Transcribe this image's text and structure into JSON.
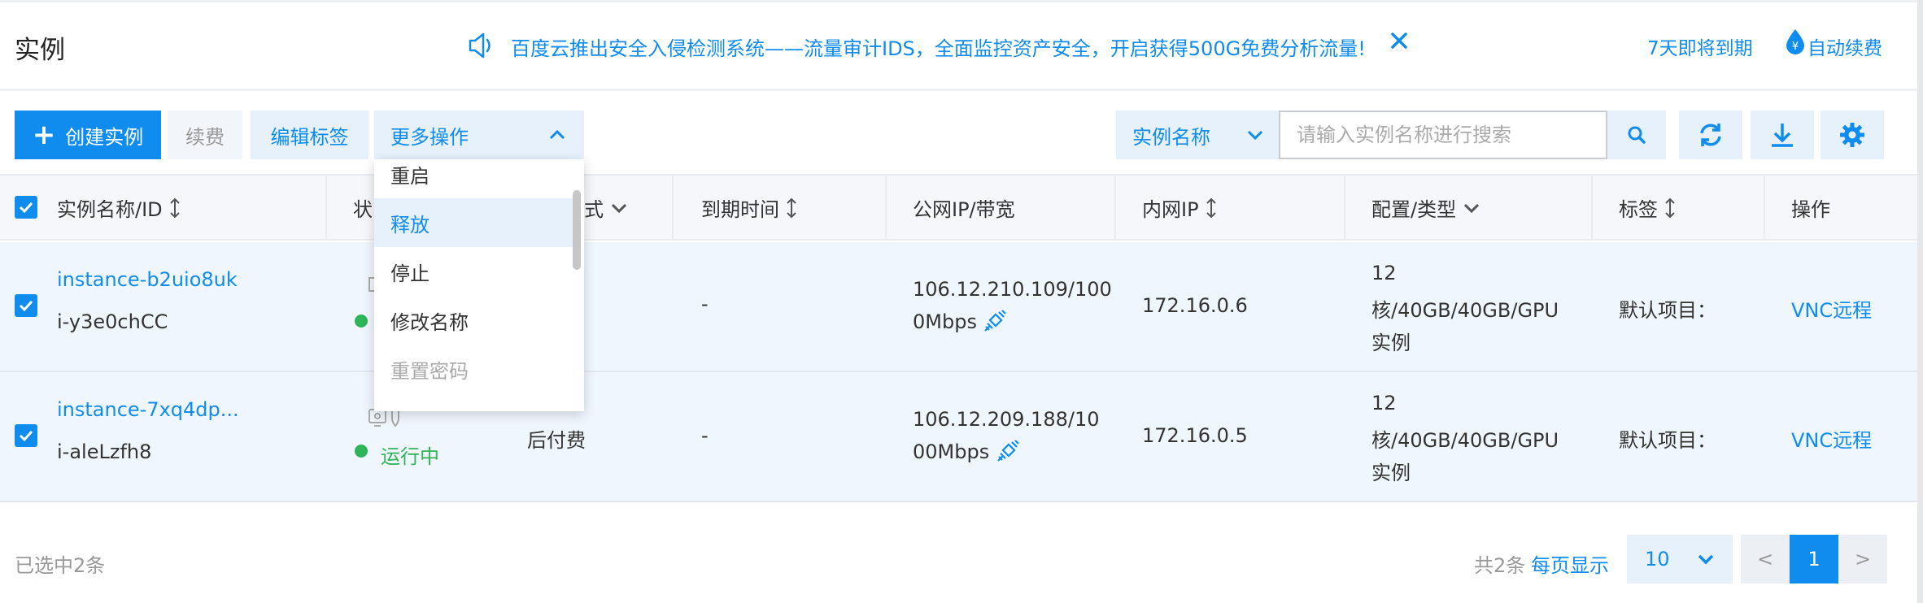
{
  "header": {
    "title": "实例",
    "notice": "百度云推出安全入侵检测系统——流量审计IDS，全面监控资产安全，开启获得500G免费分析流量!",
    "expire_text": "7天即将到期",
    "auto_renew": "自动续费"
  },
  "toolbar": {
    "create_label": "创建实例",
    "renew_label": "续费",
    "edit_tag_label": "编辑标签",
    "more_ops_label": "更多操作",
    "search_field": "实例名称",
    "search_placeholder": "请输入实例名称进行搜索"
  },
  "dropdown": {
    "items": [
      {
        "label": "重启",
        "state": "normal"
      },
      {
        "label": "释放",
        "state": "active"
      },
      {
        "label": "停止",
        "state": "normal"
      },
      {
        "label": "修改名称",
        "state": "normal"
      },
      {
        "label": "重置密码",
        "state": "disabled"
      }
    ]
  },
  "table": {
    "columns": {
      "name_id": "实例名称/ID",
      "status": "状",
      "pay_mode": "式",
      "expire_time": "到期时间",
      "public_ip": "公网IP/带宽",
      "private_ip": "内网IP",
      "config": "配置/类型",
      "tags": "标签",
      "ops": "操作"
    },
    "rows": [
      {
        "name": "instance-b2uio8uk",
        "id": "i-y3e0chCC",
        "status": "",
        "pay_mode": "",
        "expire_time": "-",
        "public_ip_line1": "106.12.210.109/100",
        "public_ip_line2": "0Mbps",
        "private_ip": "172.16.0.6",
        "config_line1": "12",
        "config_line2": "核/40GB/40GB/GPU",
        "config_line3": "实例",
        "tags": "默认项目：",
        "op": "VNC远程"
      },
      {
        "name": "instance-7xq4dp...",
        "id": "i-aleLzfh8",
        "status": "运行中",
        "pay_mode": "后付费",
        "expire_time": "-",
        "public_ip_line1": "106.12.209.188/10",
        "public_ip_line2": "00Mbps",
        "private_ip": "172.16.0.5",
        "config_line1": "12",
        "config_line2": "核/40GB/40GB/GPU",
        "config_line3": "实例",
        "tags": "默认项目：",
        "op": "VNC远程"
      }
    ]
  },
  "footer": {
    "selected": "已选中2条",
    "total": "共2条",
    "per_page_label": "每页显示",
    "page_size": "10",
    "prev": "<",
    "current_page": "1",
    "next": ">"
  },
  "colors": {
    "accent": "#108cee",
    "accent_light": "#e6f1fb",
    "success": "#2fb45a"
  }
}
